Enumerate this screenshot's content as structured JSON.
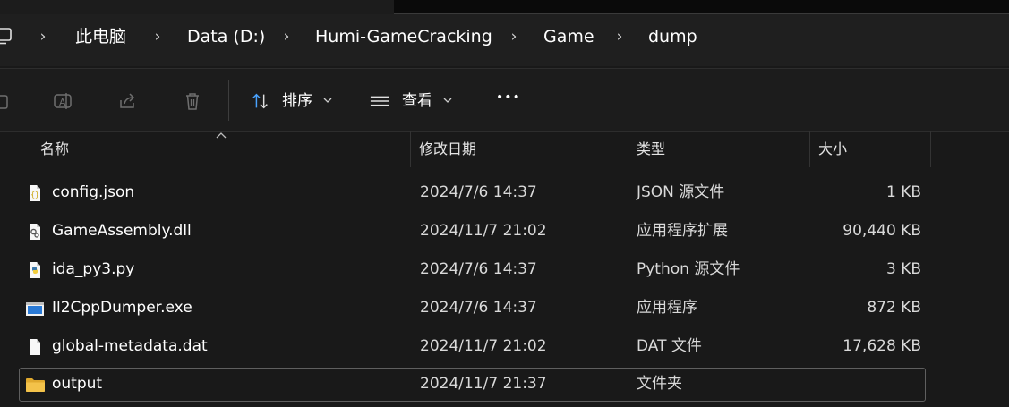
{
  "breadcrumb": [
    "此电脑",
    "Data (D:)",
    "Humi-GameCracking",
    "Game",
    "dump"
  ],
  "toolbar": {
    "sort_label": "排序",
    "view_label": "查看",
    "more_label": "•••"
  },
  "columns": {
    "name": "名称",
    "date": "修改日期",
    "type": "类型",
    "size": "大小"
  },
  "files": [
    {
      "name": "config.json",
      "date": "2024/7/6 14:37",
      "type": "JSON 源文件",
      "size": "1 KB",
      "icon": "json-file-icon"
    },
    {
      "name": "GameAssembly.dll",
      "date": "2024/11/7 21:02",
      "type": "应用程序扩展",
      "size": "90,440 KB",
      "icon": "dll-file-icon"
    },
    {
      "name": "ida_py3.py",
      "date": "2024/7/6 14:37",
      "type": "Python 源文件",
      "size": "3 KB",
      "icon": "python-file-icon"
    },
    {
      "name": "Il2CppDumper.exe",
      "date": "2024/7/6 14:37",
      "type": "应用程序",
      "size": "872 KB",
      "icon": "exe-file-icon"
    },
    {
      "name": "global-metadata.dat",
      "date": "2024/11/7 21:02",
      "type": "DAT 文件",
      "size": "17,628 KB",
      "icon": "generic-file-icon"
    },
    {
      "name": "output",
      "date": "2024/11/7 21:37",
      "type": "文件夹",
      "size": "",
      "icon": "folder-icon"
    }
  ],
  "colors": {
    "background": "#191919",
    "toolbar": "#1c1c1c",
    "folder": "#f3c24a",
    "python_blue": "#3b77a8",
    "python_yellow": "#f2cd3b",
    "exe_blue": "#2a7ad6"
  }
}
